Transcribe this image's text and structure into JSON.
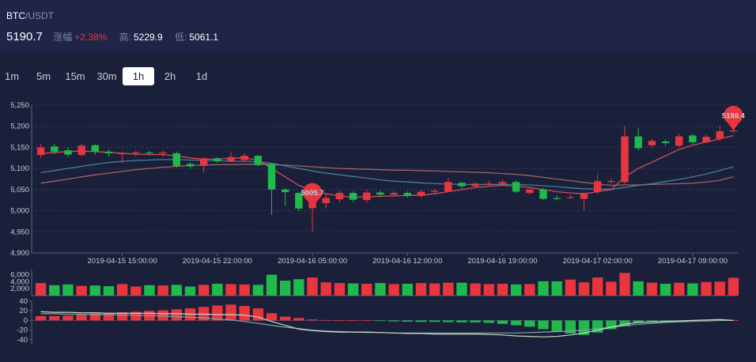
{
  "header": {
    "base": "BTC",
    "quote": "/USDT",
    "last_price": "5190.7",
    "change_label": "涨幅",
    "change_value": "+2.38%",
    "high_label": "高:",
    "high_value": "5229.9",
    "low_label": "低:",
    "low_value": "5061.1"
  },
  "intervals": [
    {
      "label": "1m",
      "active": false
    },
    {
      "label": "5m",
      "active": false
    },
    {
      "label": "15m",
      "active": false
    },
    {
      "label": "30m",
      "active": false
    },
    {
      "label": "1h",
      "active": true
    },
    {
      "label": "2h",
      "active": false
    },
    {
      "label": "1d",
      "active": false
    }
  ],
  "colors": {
    "up": "#e8363f",
    "down": "#1fba4a",
    "ma_short": "#e0555e",
    "ma_mid": "#4d8aa8",
    "ma_long": "#b06a64",
    "grid": "#3a4066",
    "background": "#1a1f3a"
  },
  "chart_data": [
    {
      "type": "candlestick",
      "ylim": [
        4900,
        5250
      ],
      "y_ticks": [
        "5,250",
        "5,200",
        "5,150",
        "5,100",
        "5,050",
        "5,000",
        "4,950",
        "4,900"
      ],
      "x_ticks": [
        "2019-04-15 15:00:00",
        "2019-04-15 22:00:00",
        "2019-04-16 05:00:00",
        "2019-04-16 12:00:00",
        "2019-04-16 19:00:00",
        "2019-04-17 02:00:00",
        "2019-04-17 09:00:00"
      ],
      "candles": [
        {
          "o": 5132,
          "c": 5150,
          "h": 5158,
          "l": 5125
        },
        {
          "o": 5152,
          "c": 5140,
          "h": 5158,
          "l": 5134
        },
        {
          "o": 5143,
          "c": 5133,
          "h": 5150,
          "l": 5128
        },
        {
          "o": 5132,
          "c": 5154,
          "h": 5159,
          "l": 5128
        },
        {
          "o": 5155,
          "c": 5140,
          "h": 5158,
          "l": 5132
        },
        {
          "o": 5140,
          "c": 5136,
          "h": 5145,
          "l": 5128
        },
        {
          "o": 5136,
          "c": 5136,
          "h": 5140,
          "l": 5113
        },
        {
          "o": 5136,
          "c": 5138,
          "h": 5142,
          "l": 5128
        },
        {
          "o": 5138,
          "c": 5137,
          "h": 5142,
          "l": 5130
        },
        {
          "o": 5138,
          "c": 5138,
          "h": 5142,
          "l": 5128
        },
        {
          "o": 5136,
          "c": 5106,
          "h": 5140,
          "l": 5102
        },
        {
          "o": 5111,
          "c": 5105,
          "h": 5114,
          "l": 5100
        },
        {
          "o": 5106,
          "c": 5124,
          "h": 5126,
          "l": 5090
        },
        {
          "o": 5124,
          "c": 5117,
          "h": 5127,
          "l": 5114
        },
        {
          "o": 5118,
          "c": 5127,
          "h": 5140,
          "l": 5115
        },
        {
          "o": 5120,
          "c": 5130,
          "h": 5136,
          "l": 5115
        },
        {
          "o": 5130,
          "c": 5108,
          "h": 5132,
          "l": 5105
        },
        {
          "o": 5111,
          "c": 5050,
          "h": 5113,
          "l": 4990
        },
        {
          "o": 5050,
          "c": 5044,
          "h": 5054,
          "l": 5012
        },
        {
          "o": 5042,
          "c": 5005,
          "h": 5045,
          "l": 4998
        },
        {
          "o": 5006,
          "c": 5038,
          "h": 5045,
          "l": 4950
        },
        {
          "o": 5018,
          "c": 5030,
          "h": 5042,
          "l": 5006
        },
        {
          "o": 5027,
          "c": 5042,
          "h": 5048,
          "l": 5020
        },
        {
          "o": 5042,
          "c": 5026,
          "h": 5046,
          "l": 5020
        },
        {
          "o": 5025,
          "c": 5043,
          "h": 5050,
          "l": 5018
        },
        {
          "o": 5043,
          "c": 5038,
          "h": 5048,
          "l": 5032
        },
        {
          "o": 5038,
          "c": 5042,
          "h": 5046,
          "l": 5034
        },
        {
          "o": 5042,
          "c": 5035,
          "h": 5046,
          "l": 5030
        },
        {
          "o": 5035,
          "c": 5045,
          "h": 5050,
          "l": 5030
        },
        {
          "o": 5045,
          "c": 5047,
          "h": 5051,
          "l": 5040
        },
        {
          "o": 5046,
          "c": 5068,
          "h": 5078,
          "l": 5044
        },
        {
          "o": 5066,
          "c": 5058,
          "h": 5070,
          "l": 5052
        },
        {
          "o": 5058,
          "c": 5064,
          "h": 5068,
          "l": 5054
        },
        {
          "o": 5064,
          "c": 5064,
          "h": 5072,
          "l": 5058
        },
        {
          "o": 5064,
          "c": 5068,
          "h": 5074,
          "l": 5060
        },
        {
          "o": 5068,
          "c": 5045,
          "h": 5072,
          "l": 5042
        },
        {
          "o": 5042,
          "c": 5050,
          "h": 5054,
          "l": 5038
        },
        {
          "o": 5050,
          "c": 5028,
          "h": 5054,
          "l": 5025
        },
        {
          "o": 5030,
          "c": 5029,
          "h": 5036,
          "l": 5024
        },
        {
          "o": 5032,
          "c": 5032,
          "h": 5038,
          "l": 5028
        },
        {
          "o": 5028,
          "c": 5042,
          "h": 5046,
          "l": 5000
        },
        {
          "o": 5045,
          "c": 5070,
          "h": 5085,
          "l": 5040
        },
        {
          "o": 5068,
          "c": 5070,
          "h": 5076,
          "l": 5064
        },
        {
          "o": 5068,
          "c": 5176,
          "h": 5200,
          "l": 5060
        },
        {
          "o": 5176,
          "c": 5148,
          "h": 5195,
          "l": 5142
        },
        {
          "o": 5155,
          "c": 5165,
          "h": 5170,
          "l": 5150
        },
        {
          "o": 5164,
          "c": 5160,
          "h": 5168,
          "l": 5154
        },
        {
          "o": 5154,
          "c": 5176,
          "h": 5182,
          "l": 5150
        },
        {
          "o": 5178,
          "c": 5162,
          "h": 5182,
          "l": 5158
        },
        {
          "o": 5162,
          "c": 5175,
          "h": 5180,
          "l": 5160
        },
        {
          "o": 5170,
          "c": 5188,
          "h": 5200,
          "l": 5165
        },
        {
          "o": 5188,
          "c": 5190,
          "h": 5195,
          "l": 5184
        }
      ],
      "markers": [
        {
          "label": "5188.4",
          "value": 5188.4
        },
        {
          "label": "5005.7",
          "value": 5005.7
        }
      ],
      "ma_short": [
        5135,
        5138,
        5140,
        5141,
        5140,
        5138,
        5136,
        5134,
        5133,
        5133,
        5130,
        5125,
        5122,
        5122,
        5124,
        5125,
        5120,
        5100,
        5080,
        5060,
        5048,
        5040,
        5035,
        5032,
        5033,
        5034,
        5035,
        5036,
        5037,
        5040,
        5045,
        5050,
        5055,
        5058,
        5060,
        5058,
        5055,
        5050,
        5045,
        5042,
        5040,
        5045,
        5050,
        5080,
        5100,
        5115,
        5130,
        5145,
        5155,
        5163,
        5170,
        5178
      ],
      "ma_mid": [
        5090,
        5095,
        5100,
        5105,
        5110,
        5114,
        5117,
        5119,
        5120,
        5121,
        5121,
        5120,
        5119,
        5118,
        5117,
        5117,
        5116,
        5112,
        5106,
        5100,
        5094,
        5089,
        5085,
        5081,
        5077,
        5073,
        5070,
        5068,
        5066,
        5064,
        5063,
        5062,
        5062,
        5062,
        5062,
        5062,
        5061,
        5059,
        5057,
        5054,
        5052,
        5051,
        5051,
        5055,
        5060,
        5064,
        5069,
        5074,
        5080,
        5087,
        5095,
        5104
      ],
      "ma_long": [
        5065,
        5070,
        5075,
        5080,
        5085,
        5089,
        5093,
        5097,
        5100,
        5103,
        5105,
        5107,
        5108,
        5109,
        5109,
        5110,
        5110,
        5109,
        5108,
        5106,
        5104,
        5102,
        5100,
        5099,
        5098,
        5097,
        5096,
        5096,
        5095,
        5094,
        5093,
        5092,
        5091,
        5090,
        5088,
        5086,
        5083,
        5079,
        5075,
        5071,
        5067,
        5063,
        5060,
        5061,
        5061,
        5062,
        5063,
        5064,
        5065,
        5068,
        5072,
        5080
      ]
    },
    {
      "type": "bar",
      "y_ticks": [
        "6,000",
        "4,000",
        "2,000"
      ],
      "ylim": [
        0,
        6800
      ],
      "volumes": [
        3600,
        3000,
        3200,
        2800,
        2900,
        2700,
        3300,
        2600,
        3000,
        2900,
        3100,
        2600,
        3100,
        3400,
        3300,
        3200,
        3100,
        6000,
        4300,
        4700,
        5200,
        3800,
        3600,
        3500,
        3400,
        3600,
        3300,
        3400,
        3600,
        3500,
        3700,
        3700,
        3500,
        3300,
        3400,
        3200,
        3300,
        4100,
        4100,
        4600,
        3800,
        5200,
        4000,
        6500,
        4100,
        3700,
        3400,
        3700,
        3500,
        3900,
        4000,
        5100
      ]
    },
    {
      "type": "bar",
      "y_ticks": [
        "40",
        "20",
        "0",
        "-20",
        "-40"
      ],
      "ylim": [
        -50,
        40
      ],
      "macd": [
        9,
        9,
        10,
        12,
        15,
        16,
        17,
        18,
        20,
        21,
        23,
        25,
        28,
        31,
        33,
        30,
        25,
        15,
        8,
        5,
        2,
        1,
        0.5,
        0.5,
        0.5,
        -1,
        -2,
        -2.5,
        -3,
        -3,
        -3.5,
        -4,
        -4,
        -5,
        -7,
        -10,
        -13,
        -18,
        -24,
        -27,
        -30,
        -25,
        -18,
        -12,
        -5,
        -2,
        -1,
        -0.5,
        0.5,
        1,
        2,
        1
      ],
      "dif": [
        18,
        17,
        17,
        16,
        16,
        15,
        15,
        15,
        15,
        14,
        14,
        13,
        13,
        12,
        12,
        11,
        7,
        -2,
        -10,
        -18,
        -21,
        -23,
        -24,
        -24,
        -24,
        -25,
        -26,
        -27,
        -27,
        -28,
        -28,
        -28,
        -28,
        -29,
        -30,
        -32,
        -33,
        -34,
        -33,
        -30,
        -26,
        -20,
        -14,
        -8,
        -4,
        -3,
        -2,
        -1,
        0,
        1,
        2,
        0
      ],
      "dea": [
        14,
        14,
        13,
        13,
        12,
        12,
        11,
        11,
        10,
        9,
        8,
        7,
        5,
        3,
        1,
        -2,
        -6,
        -10,
        -14,
        -17,
        -20,
        -22,
        -23,
        -24,
        -25,
        -25,
        -26,
        -26,
        -26,
        -26,
        -26,
        -26,
        -26,
        -26,
        -26,
        -26,
        -25,
        -24,
        -23,
        -22,
        -20,
        -17,
        -14,
        -11,
        -8,
        -6,
        -4,
        -3,
        -2,
        -1,
        0,
        0
      ]
    }
  ]
}
